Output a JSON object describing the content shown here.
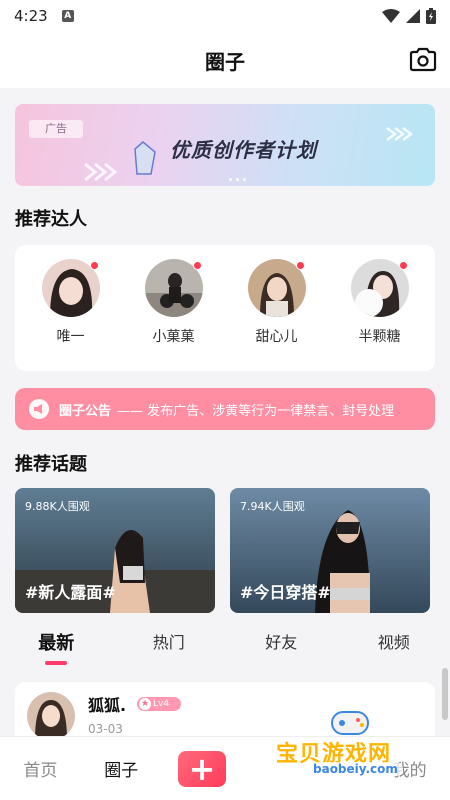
{
  "status_bar": {
    "time": "4:23",
    "notification": "A"
  },
  "header": {
    "title": "圈子"
  },
  "banner": {
    "ad_tag": "广告",
    "title": "优质创作者计划"
  },
  "experts": {
    "heading": "推荐达人",
    "items": [
      {
        "name": "唯一"
      },
      {
        "name": "小菓菓"
      },
      {
        "name": "甜心儿"
      },
      {
        "name": "半颗糖"
      }
    ]
  },
  "notice": {
    "label": "圈子公告",
    "text": "—— 发布广告、涉黄等行为一律禁言、封号处理"
  },
  "topics": {
    "heading": "推荐话题",
    "items": [
      {
        "views": "9.88K人围观",
        "tag": "#新人露面#"
      },
      {
        "views": "7.94K人围观",
        "tag": "#今日穿搭#"
      }
    ]
  },
  "tabs": {
    "items": [
      {
        "label": "最新",
        "active": true
      },
      {
        "label": "热门",
        "active": false
      },
      {
        "label": "好友",
        "active": false
      },
      {
        "label": "视频",
        "active": false
      }
    ]
  },
  "post": {
    "author": "狐狐.",
    "level": "Lv4",
    "date": "03-03"
  },
  "bottom_nav": {
    "home": "首页",
    "circle": "圈子",
    "plus": "+",
    "mine": "我的"
  },
  "watermark": {
    "text": "宝贝游戏网",
    "domain": "baobeiy.com"
  },
  "colors": {
    "accent": "#ff3c6a",
    "notice_bg": "#ff8ea3",
    "online_dot": "#ff3b4e"
  }
}
